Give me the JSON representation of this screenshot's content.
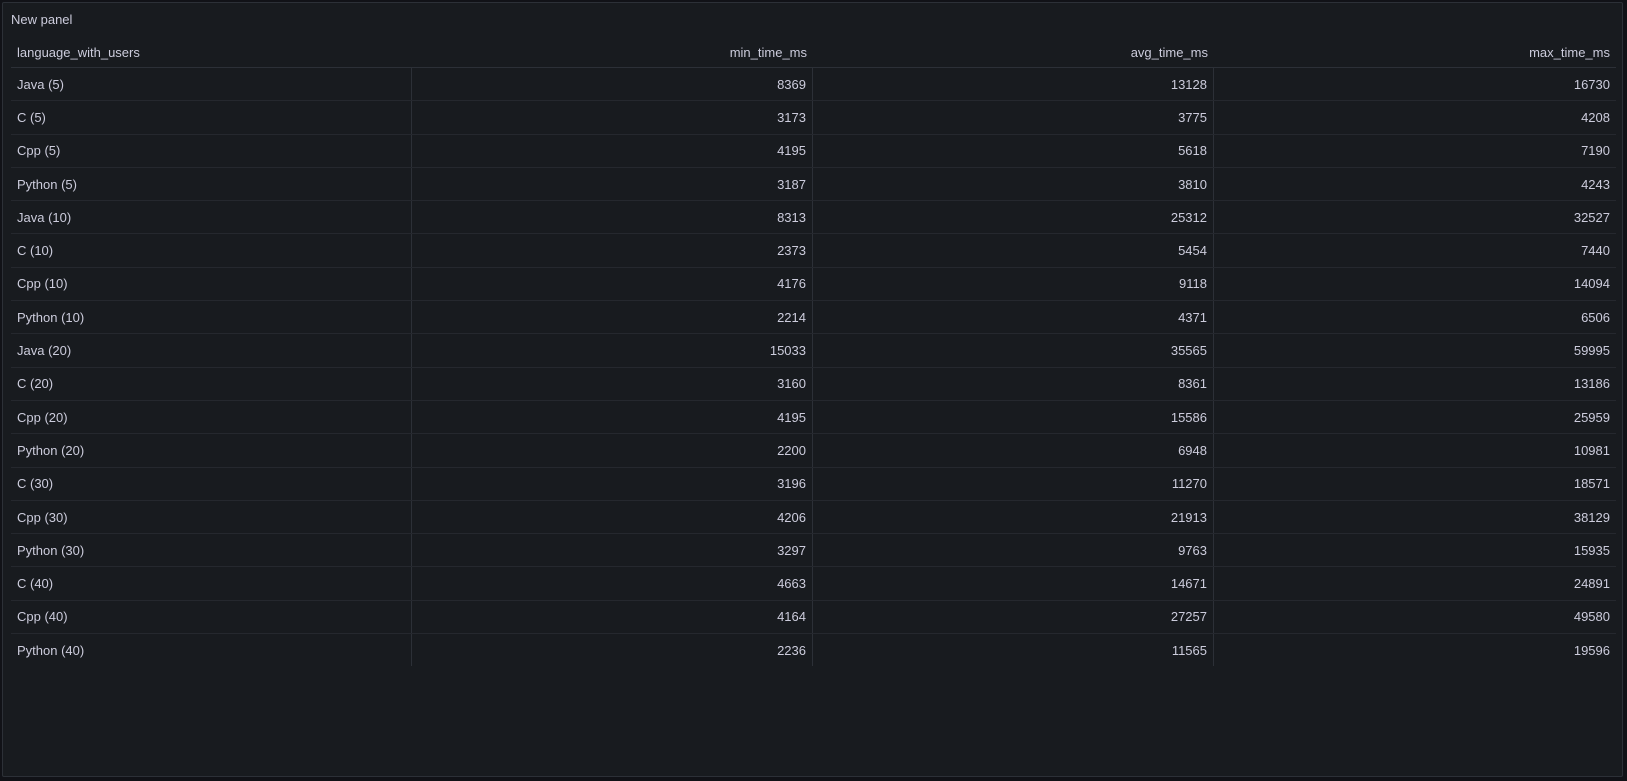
{
  "panel": {
    "title": "New panel"
  },
  "table": {
    "columns": [
      "language_with_users",
      "min_time_ms",
      "avg_time_ms",
      "max_time_ms"
    ],
    "rows": [
      [
        "Java (5)",
        "8369",
        "13128",
        "16730"
      ],
      [
        "C (5)",
        "3173",
        "3775",
        "4208"
      ],
      [
        "Cpp (5)",
        "4195",
        "5618",
        "7190"
      ],
      [
        "Python (5)",
        "3187",
        "3810",
        "4243"
      ],
      [
        "Java (10)",
        "8313",
        "25312",
        "32527"
      ],
      [
        "C (10)",
        "2373",
        "5454",
        "7440"
      ],
      [
        "Cpp (10)",
        "4176",
        "9118",
        "14094"
      ],
      [
        "Python (10)",
        "2214",
        "4371",
        "6506"
      ],
      [
        "Java (20)",
        "15033",
        "35565",
        "59995"
      ],
      [
        "C (20)",
        "3160",
        "8361",
        "13186"
      ],
      [
        "Cpp (20)",
        "4195",
        "15586",
        "25959"
      ],
      [
        "Python (20)",
        "2200",
        "6948",
        "10981"
      ],
      [
        "C (30)",
        "3196",
        "11270",
        "18571"
      ],
      [
        "Cpp (30)",
        "4206",
        "21913",
        "38129"
      ],
      [
        "Python (30)",
        "3297",
        "9763",
        "15935"
      ],
      [
        "C (40)",
        "4663",
        "14671",
        "24891"
      ],
      [
        "Cpp (40)",
        "4164",
        "27257",
        "49580"
      ],
      [
        "Python (40)",
        "2236",
        "11565",
        "19596"
      ]
    ]
  }
}
